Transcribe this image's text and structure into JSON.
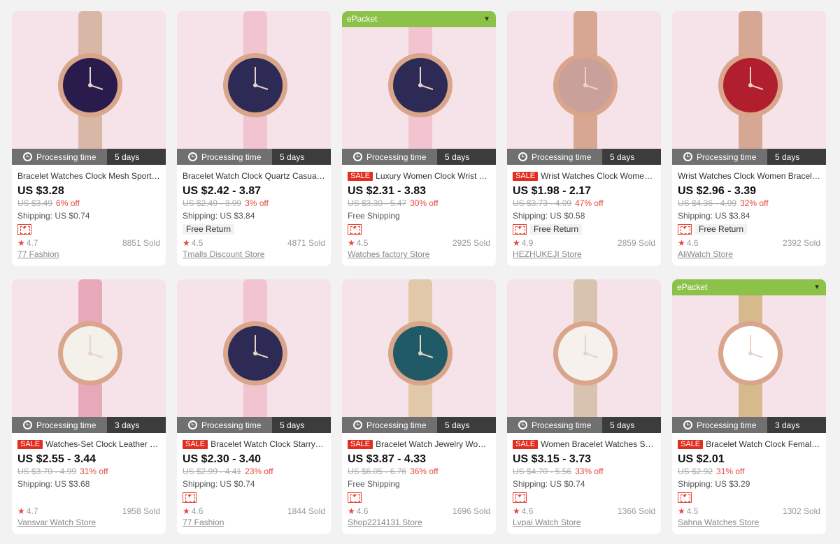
{
  "colors": {
    "accent_red": "#e22e21",
    "epacket_green": "#8cc24a",
    "processing_dark": "#3c3c3c",
    "processing_light": "#707070"
  },
  "labels": {
    "processing": "Processing time",
    "sale": "SALE",
    "epacket": "ePacket",
    "free_return": "Free Return"
  },
  "products": [
    {
      "epacket": false,
      "processing_days": "5 days",
      "sale": false,
      "title": "Bracelet Watches Clock Mesh Sporty Magnet",
      "price": "US $3.28",
      "original_price": "US $3.49",
      "discount": "6% off",
      "shipping": "Shipping: US $0.74",
      "coupon": true,
      "free_return": false,
      "rating": "4.7",
      "sold": "8851 Sold",
      "store": "77 Fashion",
      "watch_color": "#2a1b4d",
      "strap_color": "#d9b7a7"
    },
    {
      "epacket": false,
      "processing_days": "5 days",
      "sale": false,
      "title": "Bracelet Watch Clock Quartz Casual Women",
      "price": "US $2.42 - 3.87",
      "original_price": "US $2.49 - 3.99",
      "discount": "3% off",
      "shipping": "Shipping: US $3.84",
      "coupon": false,
      "free_return": true,
      "rating": "4.5",
      "sold": "4871 Sold",
      "store": "Tmalls Discount Store",
      "watch_color": "#2d2b55",
      "strap_color": "#f2c4cf"
    },
    {
      "epacket": true,
      "processing_days": "5 days",
      "sale": true,
      "title": "Luxury Women Clock Wrist Watch Set",
      "price": "US $2.31 - 3.83",
      "original_price": "US $3.30 - 5.47",
      "discount": "30% off",
      "shipping": "Free Shipping",
      "coupon": true,
      "free_return": false,
      "rating": "4.5",
      "sold": "2925 Sold",
      "store": "Watches factory Store",
      "watch_color": "#2d2b55",
      "strap_color": "#f2c4cf"
    },
    {
      "epacket": false,
      "processing_days": "5 days",
      "sale": true,
      "title": "Wrist Watches Clock Women Rose Gold",
      "price": "US $1.98 - 2.17",
      "original_price": "US $3.73 - 4.09",
      "discount": "47% off",
      "shipping": "Shipping: US $0.58",
      "coupon": true,
      "free_return": true,
      "rating": "4.9",
      "sold": "2859 Sold",
      "store": "HEZHUKEJI Store",
      "watch_color": "#caa09a",
      "strap_color": "#d8a793"
    },
    {
      "epacket": false,
      "processing_days": "5 days",
      "sale": false,
      "title": "Wrist Watches Clock Women Bracelet Set",
      "price": "US $2.96 - 3.39",
      "original_price": "US $4.36 - 4.99",
      "discount": "32% off",
      "shipping": "Shipping: US $3.84",
      "coupon": true,
      "free_return": true,
      "rating": "4.6",
      "sold": "2392 Sold",
      "store": "AliWatch Store",
      "watch_color": "#b11e2e",
      "strap_color": "#d8a793"
    },
    {
      "epacket": false,
      "processing_days": "3 days",
      "sale": true,
      "title": "Watches-Set Clock Leather Strap Women",
      "price": "US $2.55 - 3.44",
      "original_price": "US $3.70 - 4.99",
      "discount": "31% off",
      "shipping": "Shipping: US $3.68",
      "coupon": false,
      "free_return": false,
      "rating": "4.7",
      "sold": "1958 Sold",
      "store": "Vansvar Watch Store",
      "watch_color": "#f4f0ea",
      "strap_color": "#e7a9ba"
    },
    {
      "epacket": false,
      "processing_days": "5 days",
      "sale": true,
      "title": "Bracelet Watch Clock Starry Sky Set",
      "price": "US $2.30 - 3.40",
      "original_price": "US $2.99 - 4.41",
      "discount": "23% off",
      "shipping": "Shipping: US $0.74",
      "coupon": true,
      "free_return": false,
      "rating": "4.6",
      "sold": "1844 Sold",
      "store": "77 Fashion",
      "watch_color": "#2d2b55",
      "strap_color": "#f2c4cf"
    },
    {
      "epacket": false,
      "processing_days": "5 days",
      "sale": true,
      "title": "Bracelet Watch Jewelry Women Malachite",
      "price": "US $3.87 - 4.33",
      "original_price": "US $6.05 - 6.76",
      "discount": "36% off",
      "shipping": "Free Shipping",
      "coupon": true,
      "free_return": false,
      "rating": "4.6",
      "sold": "1696 Sold",
      "store": "Shop2214131 Store",
      "watch_color": "#1f5a66",
      "strap_color": "#e0c8a8"
    },
    {
      "epacket": false,
      "processing_days": "5 days",
      "sale": true,
      "title": "Women Bracelet Watches Stainless",
      "price": "US $3.15 - 3.73",
      "original_price": "US $4.70 - 5.56",
      "discount": "33% off",
      "shipping": "Shipping: US $0.74",
      "coupon": true,
      "free_return": false,
      "rating": "4.6",
      "sold": "1366 Sold",
      "store": "Lvpai Watch Store",
      "watch_color": "#f6f1ec",
      "strap_color": "#d8c2b0"
    },
    {
      "epacket": true,
      "processing_days": "3 days",
      "sale": true,
      "title": "Bracelet Watch Clock Female Wrap",
      "price": "US $2.01",
      "original_price": "US $2.92",
      "discount": "31% off",
      "shipping": "Shipping: US $3.29",
      "coupon": true,
      "free_return": false,
      "rating": "4.5",
      "sold": "1302 Sold",
      "store": "Sahna Watches Store",
      "watch_color": "#ffffff",
      "strap_color": "#d6b98c"
    }
  ]
}
